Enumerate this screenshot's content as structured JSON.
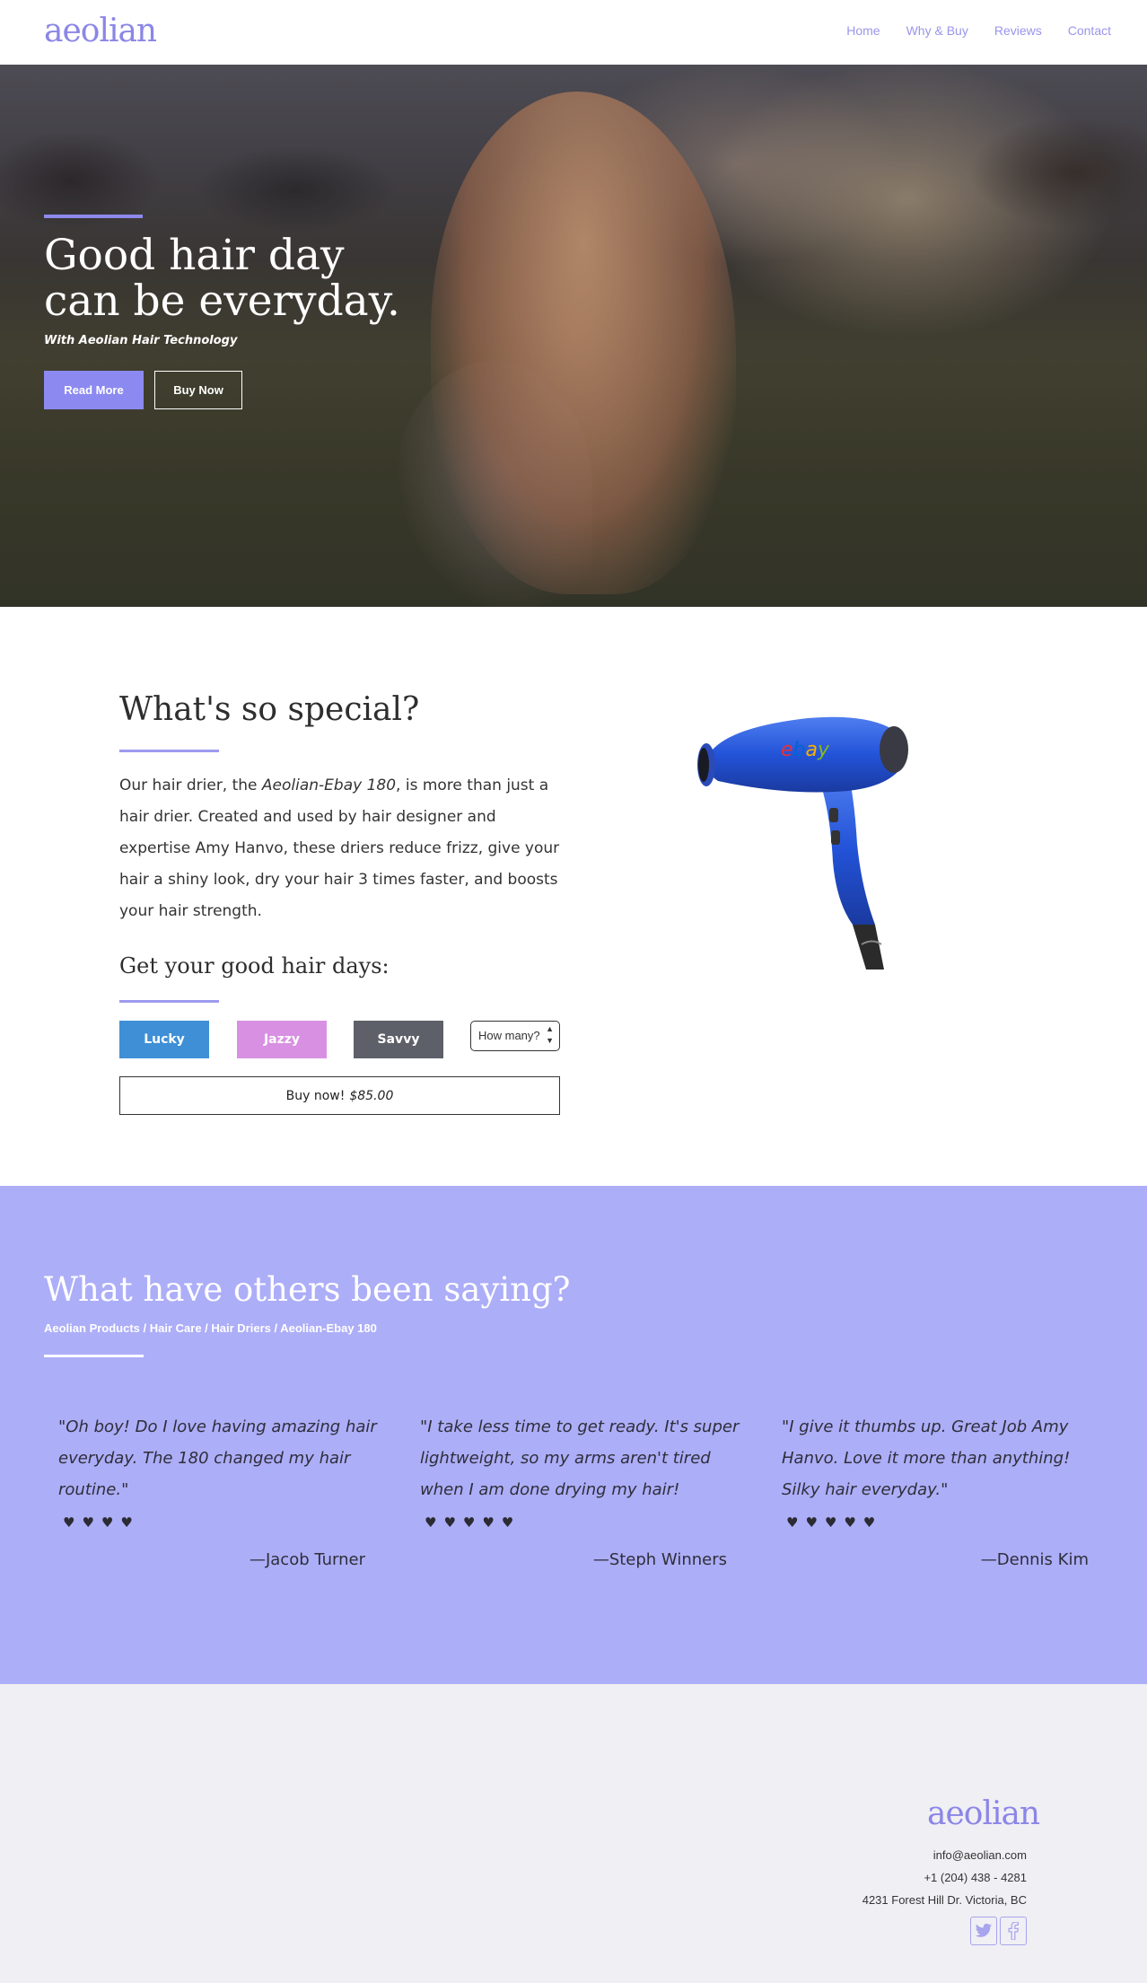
{
  "brand": {
    "logo_text": "aeolian",
    "accent": "#8c8af0",
    "reviews_bg": "#adaef8",
    "footer_bg": "#f0eff4"
  },
  "nav": {
    "items": [
      "Home",
      "Why & Buy",
      "Reviews",
      "Contact"
    ]
  },
  "hero": {
    "title_line1": "Good hair day",
    "title_line2": "can be everyday.",
    "subtitle": "With Aeolian Hair Technology",
    "read_more": "Read More",
    "buy_now": "Buy Now"
  },
  "special": {
    "title": "What's so special?",
    "text_prefix": "Our hair drier, the ",
    "product_name": "Aeolian-Ebay 180",
    "text_suffix": ", is more than just a hair drier. Created and used by hair designer and expertise Amy Hanvo, these driers reduce frizz, give your hair a shiny look, dry your hair 3 times faster, and boosts your hair strength.",
    "get_title": "Get your good hair days:",
    "variants": [
      {
        "label": "Lucky",
        "color": "#3f8fd6"
      },
      {
        "label": "Jazzy",
        "color": "#d890e2"
      },
      {
        "label": "Savvy",
        "color": "#5d6068"
      }
    ],
    "quantity_placeholder": "How many?",
    "buy_label": "Buy now!",
    "price": "$85.00",
    "product_logo": "ebay"
  },
  "reviews": {
    "title": "What have others been saying?",
    "breadcrumb": "Aeolian Products / Hair Care / Hair Driers / Aeolian-Ebay 180",
    "items": [
      {
        "quote": "\"Oh boy! Do I love having amazing hair everyday. The 180 changed my hair routine.\"",
        "stars": 4,
        "stars_text": "♥♥♥♥",
        "author": "—Jacob Turner"
      },
      {
        "quote": "\"I take less time to get ready. It's super lightweight, so my arms aren't tired when I am done drying my hair!",
        "stars": 5,
        "stars_text": "♥♥♥♥♥",
        "author": "—Steph Winners"
      },
      {
        "quote": "\"I give it thumbs up. Great Job Amy Hanvo. Love it more than anything! Silky hair everyday.\"",
        "stars": 5,
        "stars_text": "♥♥♥♥♥",
        "author": "—Dennis Kim"
      }
    ]
  },
  "footer": {
    "logo_text": "aeolian",
    "email": "info@aeolian.com",
    "phone": "+1 (204) 438 - 4281",
    "address": "4231 Forest Hill Dr. Victoria, BC",
    "social": [
      "twitter-icon",
      "facebook-icon"
    ]
  }
}
